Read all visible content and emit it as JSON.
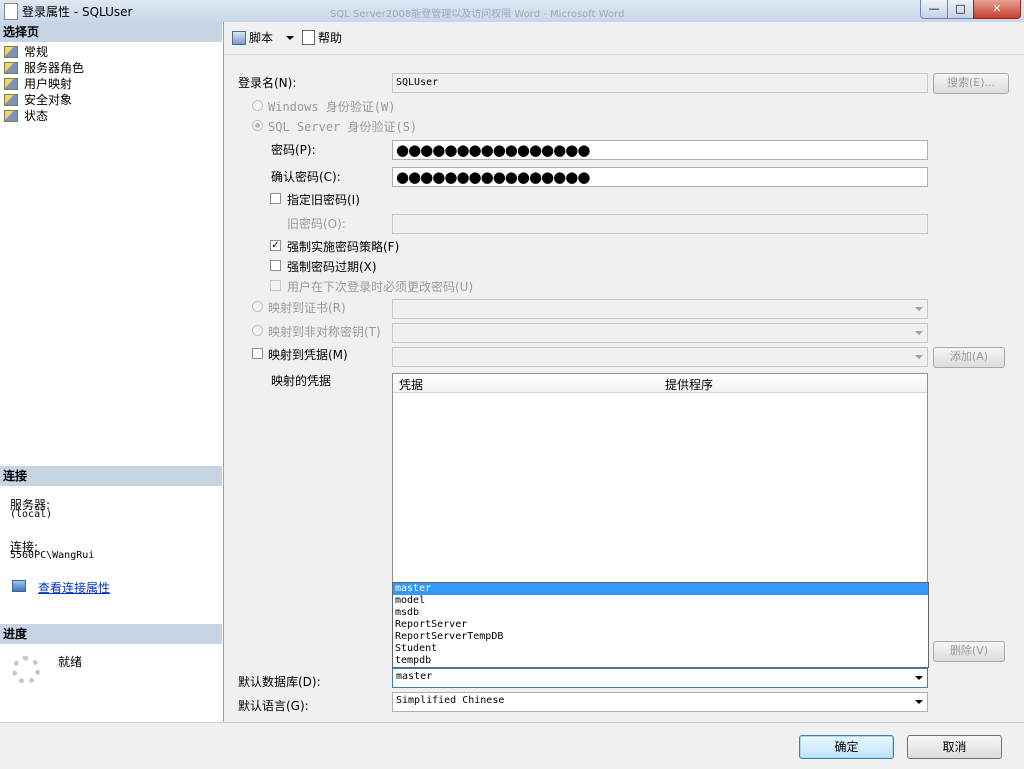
{
  "window": {
    "title": "登录属性 - SQLUser",
    "background_title": "SQL Server2008能登管理以及访问权限 Word - Microsoft Word",
    "minimize_glyph": "—",
    "maximize_glyph": "□",
    "close_glyph": "✕"
  },
  "left_panel": {
    "select_page_header": "选择页",
    "pages": [
      "常规",
      "服务器角色",
      "用户映射",
      "安全对象",
      "状态"
    ],
    "connection_header": "连接",
    "server_label": "服务器:",
    "server_value": "(local)",
    "connection_label": "连接:",
    "connection_value": "5560PC\\WangRui",
    "view_connection_link": "查看连接属性",
    "progress_header": "进度",
    "progress_status": "就绪"
  },
  "toolbar": {
    "script_label": "脚本",
    "help_label": "帮助"
  },
  "form": {
    "login_name_label": "登录名(N):",
    "login_name_value": "SQLUser",
    "search_button": "搜索(E)...",
    "windows_auth": "Windows 身份验证(W)",
    "sql_auth": "SQL Server 身份验证(S)",
    "password_label": "密码(P):",
    "password_value": "●●●●●●●●●●●●●●●●",
    "confirm_password_label": "确认密码(C):",
    "confirm_password_value": "●●●●●●●●●●●●●●●●",
    "specify_old_password": "指定旧密码(I)",
    "old_password_label": "旧密码(O):",
    "enforce_policy": "强制实施密码策略(F)",
    "enforce_policy_checked": true,
    "enforce_expiration": "强制密码过期(X)",
    "must_change": "用户在下次登录时必须更改密码(U)",
    "map_certificate": "映射到证书(R)",
    "map_asymmetric_key": "映射到非对称密钥(T)",
    "map_credential": "映射到凭据(M)",
    "add_button": "添加(A)",
    "mapped_credentials_label": "映射的凭据",
    "grid_columns": [
      "凭据",
      "提供程序"
    ],
    "remove_button": "删除(V)",
    "default_db_label": "默认数据库(D):",
    "default_db_value": "master",
    "default_db_options": [
      "master",
      "model",
      "msdb",
      "ReportServer",
      "ReportServerTempDB",
      "Student",
      "tempdb"
    ],
    "default_language_label": "默认语言(G):",
    "default_language_value": "Simplified Chinese"
  },
  "footer": {
    "ok_button": "确定",
    "cancel_button": "取消"
  },
  "colors": {
    "section_header": "#c7d4e4",
    "selection": "#3399ff",
    "link": "#0033cc"
  }
}
